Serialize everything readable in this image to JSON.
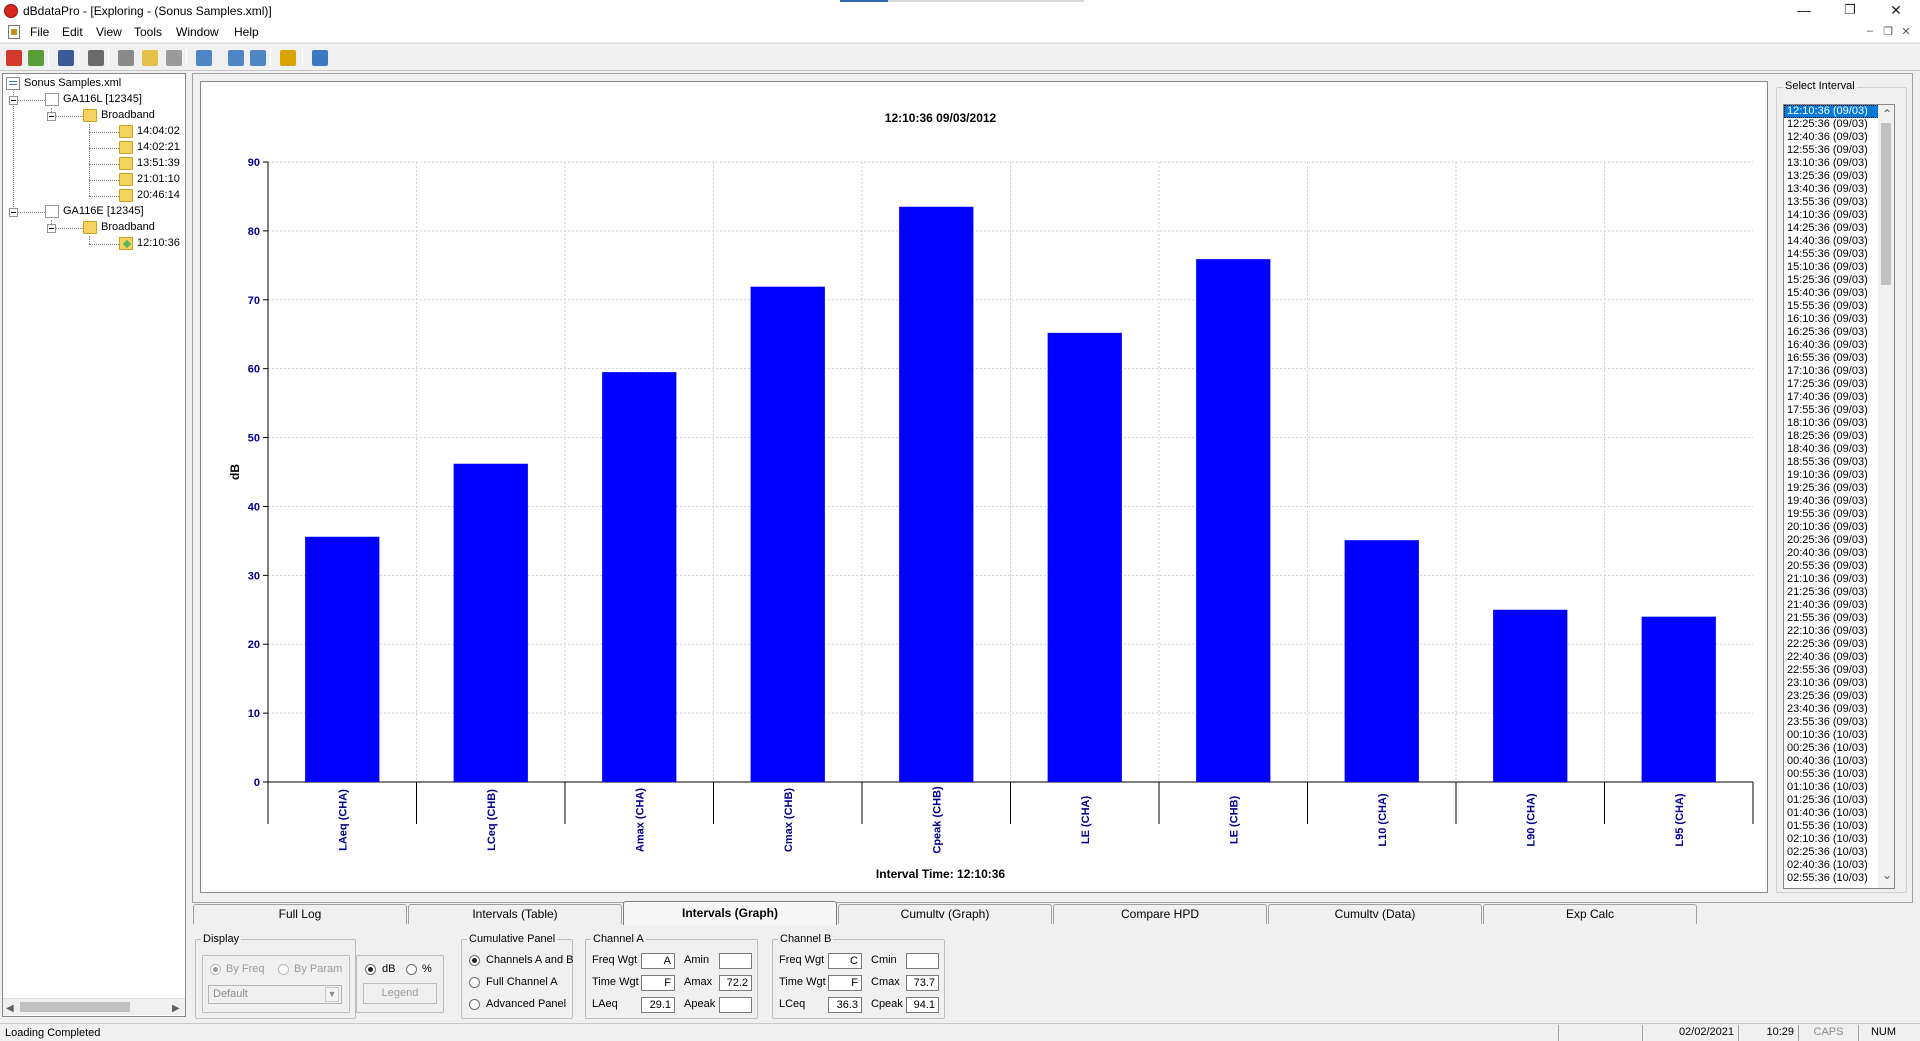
{
  "window": {
    "title": "dBdataPro - [Exploring - (Sonus Samples.xml)]",
    "minimize_glyph": "—",
    "restore_glyph": "❐",
    "close_glyph": "✕",
    "mdi_minimize_glyph": "–",
    "mdi_restore_glyph": "❐",
    "mdi_close_glyph": "✕"
  },
  "menu": [
    "File",
    "Edit",
    "View",
    "Tools",
    "Window",
    "Help"
  ],
  "toolbar": {
    "buttons": [
      {
        "name": "exit-icon",
        "color": "#d33a2c"
      },
      {
        "name": "import-icon",
        "color": "#5a9e3a"
      },
      {
        "name": "save-icon",
        "color": "#3c5a9a"
      },
      {
        "name": "print-icon",
        "color": "#6b6b6b"
      },
      {
        "name": "cut-icon",
        "color": "#8a8a8a"
      },
      {
        "name": "copy-icon",
        "color": "#e6c14a"
      },
      {
        "name": "paste-icon",
        "color": "#9a9a9a"
      },
      {
        "name": "find-icon",
        "color": "#4f86c6"
      },
      {
        "name": "export-icon",
        "color": "#4f86c6"
      },
      {
        "name": "report-icon",
        "color": "#4f86c6"
      },
      {
        "name": "clock-icon",
        "color": "#d9a400"
      },
      {
        "name": "home-icon",
        "color": "#3a78c3"
      }
    ]
  },
  "tree": {
    "root": "Sonus Samples.xml",
    "devices": [
      {
        "label": "GA116L [12345]",
        "folder": "Broadband",
        "items": [
          "14:04:02",
          "14:02:21",
          "13:51:39",
          "21:01:10",
          "20:46:14"
        ]
      },
      {
        "label": "GA116E [12345]",
        "folder": "Broadband",
        "items": [
          "12:10:36"
        ]
      }
    ],
    "scroll_left": "◀",
    "scroll_right": "▶"
  },
  "chart_data": {
    "type": "bar",
    "title": "12:10:36 09/03/2012",
    "xlabel": "Interval Time: 12:10:36",
    "ylabel": "dB",
    "categories": [
      "LAeq (CHA)",
      "LCeq (CHB)",
      "Amax (CHA)",
      "Cmax (CHB)",
      "Cpeak (CHB)",
      "LE (CHA)",
      "LE (CHB)",
      "L10 (CHA)",
      "L90 (CHA)",
      "L95 (CHA)"
    ],
    "values": [
      35.6,
      46.2,
      59.5,
      71.9,
      83.5,
      65.2,
      75.9,
      35.1,
      25.0,
      24.0
    ],
    "ylim": [
      0,
      90
    ],
    "yticks": [
      0,
      10,
      20,
      30,
      40,
      50,
      60,
      70,
      80,
      90
    ],
    "grid": true,
    "bar_color": "#0000ff",
    "axis_text_color": "#00008b"
  },
  "select_interval": {
    "label": "Select Interval",
    "selected_index": 0,
    "items": [
      "12:10:36 (09/03)",
      "12:25:36 (09/03)",
      "12:40:36 (09/03)",
      "12:55:36 (09/03)",
      "13:10:36 (09/03)",
      "13:25:36 (09/03)",
      "13:40:36 (09/03)",
      "13:55:36 (09/03)",
      "14:10:36 (09/03)",
      "14:25:36 (09/03)",
      "14:40:36 (09/03)",
      "14:55:36 (09/03)",
      "15:10:36 (09/03)",
      "15:25:36 (09/03)",
      "15:40:36 (09/03)",
      "15:55:36 (09/03)",
      "16:10:36 (09/03)",
      "16:25:36 (09/03)",
      "16:40:36 (09/03)",
      "16:55:36 (09/03)",
      "17:10:36 (09/03)",
      "17:25:36 (09/03)",
      "17:40:36 (09/03)",
      "17:55:36 (09/03)",
      "18:10:36 (09/03)",
      "18:25:36 (09/03)",
      "18:40:36 (09/03)",
      "18:55:36 (09/03)",
      "19:10:36 (09/03)",
      "19:25:36 (09/03)",
      "19:40:36 (09/03)",
      "19:55:36 (09/03)",
      "20:10:36 (09/03)",
      "20:25:36 (09/03)",
      "20:40:36 (09/03)",
      "20:55:36 (09/03)",
      "21:10:36 (09/03)",
      "21:25:36 (09/03)",
      "21:40:36 (09/03)",
      "21:55:36 (09/03)",
      "22:10:36 (09/03)",
      "22:25:36 (09/03)",
      "22:40:36 (09/03)",
      "22:55:36 (09/03)",
      "23:10:36 (09/03)",
      "23:25:36 (09/03)",
      "23:40:36 (09/03)",
      "23:55:36 (09/03)",
      "00:10:36 (10/03)",
      "00:25:36 (10/03)",
      "00:40:36 (10/03)",
      "00:55:36 (10/03)",
      "01:10:36 (10/03)",
      "01:25:36 (10/03)",
      "01:40:36 (10/03)",
      "01:55:36 (10/03)",
      "02:10:36 (10/03)",
      "02:25:36 (10/03)",
      "02:40:36 (10/03)",
      "02:55:36 (10/03)"
    ],
    "scroll_up": "⌃",
    "scroll_down": "⌄"
  },
  "tabs": [
    {
      "label": "Full Log",
      "active": false
    },
    {
      "label": "Intervals (Table)",
      "active": false
    },
    {
      "label": "Intervals (Graph)",
      "active": true
    },
    {
      "label": "Cumultv (Graph)",
      "active": false
    },
    {
      "label": "Compare HPD",
      "active": false
    },
    {
      "label": "Cumultv (Data)",
      "active": false
    },
    {
      "label": "Exp Calc",
      "active": false
    }
  ],
  "display": {
    "title": "Display",
    "by_freq": "By Freq",
    "by_param": "By Param",
    "combo_value": "Default",
    "combo_arrow": "▼",
    "db": "dB",
    "percent": "%",
    "legend": "Legend"
  },
  "cumulative": {
    "title": "Cumulative Panel",
    "options": [
      "Channels A and B",
      "Full Channel A",
      "Advanced Panel"
    ],
    "selected": 0
  },
  "channel_a": {
    "title": "Channel A",
    "freq_wgt_label": "Freq Wgt",
    "freq_wgt": "A",
    "time_wgt_label": "Time Wgt",
    "time_wgt": "F",
    "leq_label": "LAeq",
    "leq": "29.1",
    "min_label": "Amin",
    "min": "",
    "max_label": "Amax",
    "max": "72.2",
    "peak_label": "Apeak",
    "peak": ""
  },
  "channel_b": {
    "title": "Channel B",
    "freq_wgt_label": "Freq Wgt",
    "freq_wgt": "C",
    "time_wgt_label": "Time Wgt",
    "time_wgt": "F",
    "leq_label": "LCeq",
    "leq": "36.3",
    "min_label": "Cmin",
    "min": "",
    "max_label": "Cmax",
    "max": "73.7",
    "peak_label": "Cpeak",
    "peak": "94.1"
  },
  "status": {
    "message": "Loading Completed",
    "date": "02/02/2021",
    "time": "10:29",
    "caps": "CAPS",
    "num": "NUM"
  }
}
